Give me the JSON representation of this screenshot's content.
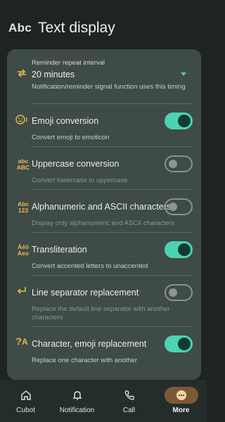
{
  "header": {
    "icon_text": "Abc",
    "title": "Text display"
  },
  "reminder": {
    "label": "Reminder repeat interval",
    "value": "20 minutes",
    "desc": "Notification/reminder signal function uses this timing"
  },
  "settings": [
    {
      "icon_text": ":)",
      "title": "Emoji conversion",
      "desc": "Convert emoji to emoticon",
      "enabled": true
    },
    {
      "icon_text": "abc ABC",
      "title": "Uppercase conversion",
      "desc": "Convert lowercase to uppercase",
      "enabled": false
    },
    {
      "icon_text": "Abc 123",
      "title": "Alphanumeric and ASCII characters",
      "desc": "Display only alphanumeric and ASCII characters",
      "enabled": false
    },
    {
      "icon_text": "Áéö Aeo",
      "title": "Transliteration",
      "desc": "Convert accented letters to unaccented",
      "enabled": true
    },
    {
      "icon_text": "↩",
      "title": "Line separator replacement",
      "desc": "Replace the default line separator with another characters",
      "enabled": false
    },
    {
      "icon_text": "?A",
      "title": "Character, emoji replacement",
      "desc": "Replace one character with another",
      "enabled": true
    }
  ],
  "nav": [
    {
      "label": "Cubot",
      "icon": "home-icon"
    },
    {
      "label": "Notification",
      "icon": "bell-icon"
    },
    {
      "label": "Call",
      "icon": "phone-icon"
    },
    {
      "label": "More",
      "icon": "more-icon",
      "active": true
    }
  ],
  "colors": {
    "accent": "#4cd3b4",
    "icon_accent": "#e9b955",
    "active_nav": "#7a5a35"
  }
}
